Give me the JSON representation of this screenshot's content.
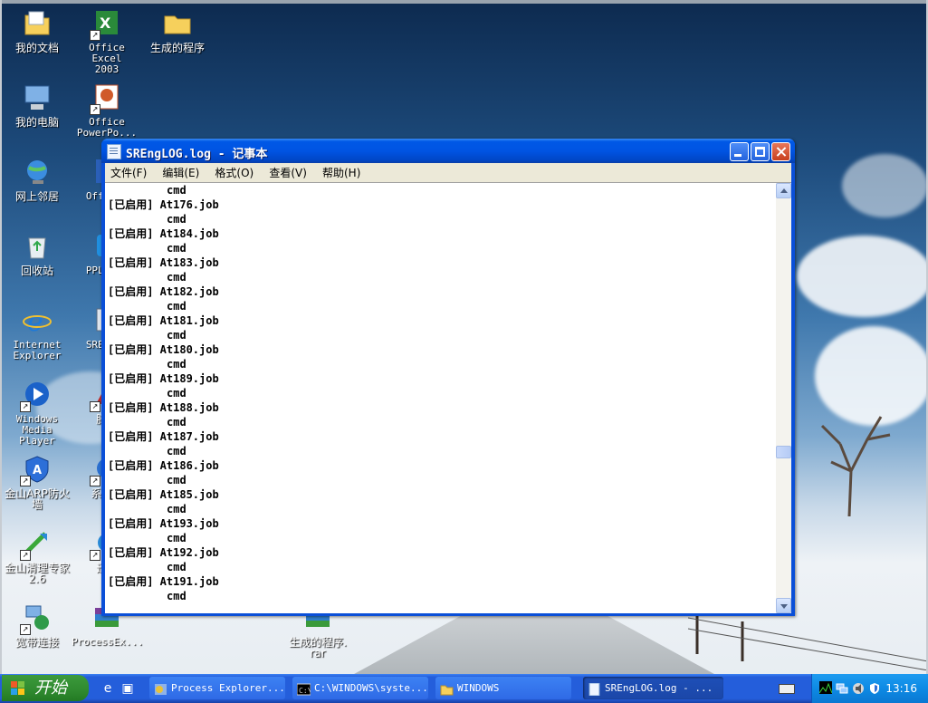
{
  "desktop": {
    "icons": [
      {
        "id": "my-documents",
        "label": "我的文档"
      },
      {
        "id": "office-excel",
        "label": "Office Excel\n2003"
      },
      {
        "id": "generated-program-folder",
        "label": "生成的程序"
      },
      {
        "id": "my-computer",
        "label": "我的电脑"
      },
      {
        "id": "office-powerpoint",
        "label": "Office\nPowerPo..."
      },
      {
        "id": "network-places",
        "label": "网上邻居"
      },
      {
        "id": "office-word",
        "label": "Offi..."
      },
      {
        "id": "recycle-bin",
        "label": "回收站"
      },
      {
        "id": "pplive",
        "label": "PPLi..."
      },
      {
        "id": "internet-explorer",
        "label": "Internet\nExplorer"
      },
      {
        "id": "srengine",
        "label": "SREn..."
      },
      {
        "id": "media-player",
        "label": "Windows\nMedia Player"
      },
      {
        "id": "tencent",
        "label": "腾..."
      },
      {
        "id": "arp-firewall",
        "label": "金山ARP防火\n墙"
      },
      {
        "id": "system-tool",
        "label": "系统..."
      },
      {
        "id": "cleaner",
        "label": "金山清理专家\n2.6"
      },
      {
        "id": "misc-shortcut",
        "label": "迅..."
      },
      {
        "id": "broadband",
        "label": "宽带连接"
      },
      {
        "id": "processexp-archive",
        "label": "ProcessEx..."
      },
      {
        "id": "generated-program-rar",
        "label": "生成的程序.\nrar"
      }
    ]
  },
  "window": {
    "title": "SREngLOG.log - 记事本",
    "menu": [
      "文件(F)",
      "编辑(E)",
      "格式(O)",
      "查看(V)",
      "帮助(H)"
    ],
    "lines": [
      "         cmd",
      "[已启用] At176.job",
      "         cmd",
      "[已启用] At184.job",
      "         cmd",
      "[已启用] At183.job",
      "         cmd",
      "[已启用] At182.job",
      "         cmd",
      "[已启用] At181.job",
      "         cmd",
      "[已启用] At180.job",
      "         cmd",
      "[已启用] At189.job",
      "         cmd",
      "[已启用] At188.job",
      "         cmd",
      "[已启用] At187.job",
      "         cmd",
      "[已启用] At186.job",
      "         cmd",
      "[已启用] At185.job",
      "         cmd",
      "[已启用] At193.job",
      "         cmd",
      "[已启用] At192.job",
      "         cmd",
      "[已启用] At191.job",
      "         cmd"
    ],
    "scroll_position": 0.64
  },
  "taskbar": {
    "start_label": "开始",
    "tasks": [
      {
        "label": "Process Explorer...",
        "icon": "process-explorer-icon",
        "active": false
      },
      {
        "label": "C:\\WINDOWS\\syste...",
        "icon": "cmd-icon",
        "active": false
      },
      {
        "label": "WINDOWS",
        "icon": "folder-icon",
        "active": false
      },
      {
        "label": "SREngLOG.log - ...",
        "icon": "notepad-icon",
        "active": true
      }
    ],
    "clock": "13:16"
  },
  "colors": {
    "titlebar": "#0054e3",
    "taskbar": "#245edb",
    "start_button": "#2f8a2f",
    "tray": "#0e8ae4"
  }
}
